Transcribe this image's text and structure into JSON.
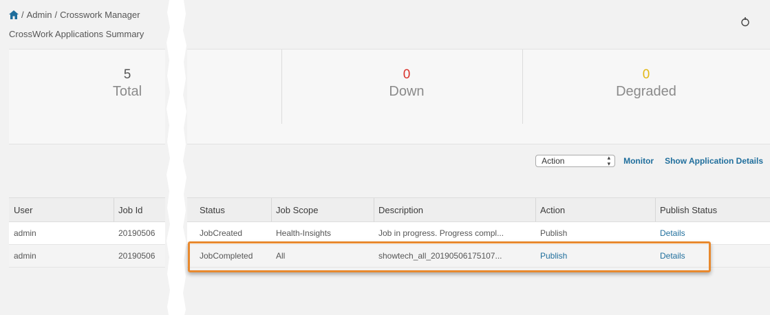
{
  "breadcrumb": {
    "admin": "Admin",
    "sep": "/",
    "current": "Crosswork Manager"
  },
  "subtitle": "CrossWork Applications Summary",
  "summary": {
    "total": {
      "value": "5",
      "label": "Total"
    },
    "down": {
      "value": "0",
      "label": "Down"
    },
    "degraded": {
      "value": "0",
      "label": "Degraded"
    }
  },
  "toolbar": {
    "action_select": "Action",
    "monitor": "Monitor",
    "show_details": "Show Application Details"
  },
  "table": {
    "headers": {
      "user": "User",
      "job_id": "Job Id",
      "status": "Status",
      "job_scope": "Job Scope",
      "description": "Description",
      "action": "Action",
      "publish_status": "Publish Status"
    },
    "rows": [
      {
        "user": "admin",
        "job_id": "20190506",
        "status": "JobCreated",
        "job_scope": "Health-Insights",
        "description": "Job in progress. Progress compl...",
        "action": "Publish",
        "publish_status": "Details"
      },
      {
        "user": "admin",
        "job_id": "20190506",
        "status": "JobCompleted",
        "job_scope": "All",
        "description": "showtech_all_20190506175107...",
        "action": "Publish",
        "publish_status": "Details"
      }
    ]
  },
  "colors": {
    "link": "#1f6e9c",
    "down": "#d9322b",
    "degraded": "#e2b714",
    "highlight": "#e8892e"
  },
  "icons": {
    "home": "home-icon",
    "refresh": "refresh-icon",
    "select_arrows": "select-arrows-icon"
  }
}
